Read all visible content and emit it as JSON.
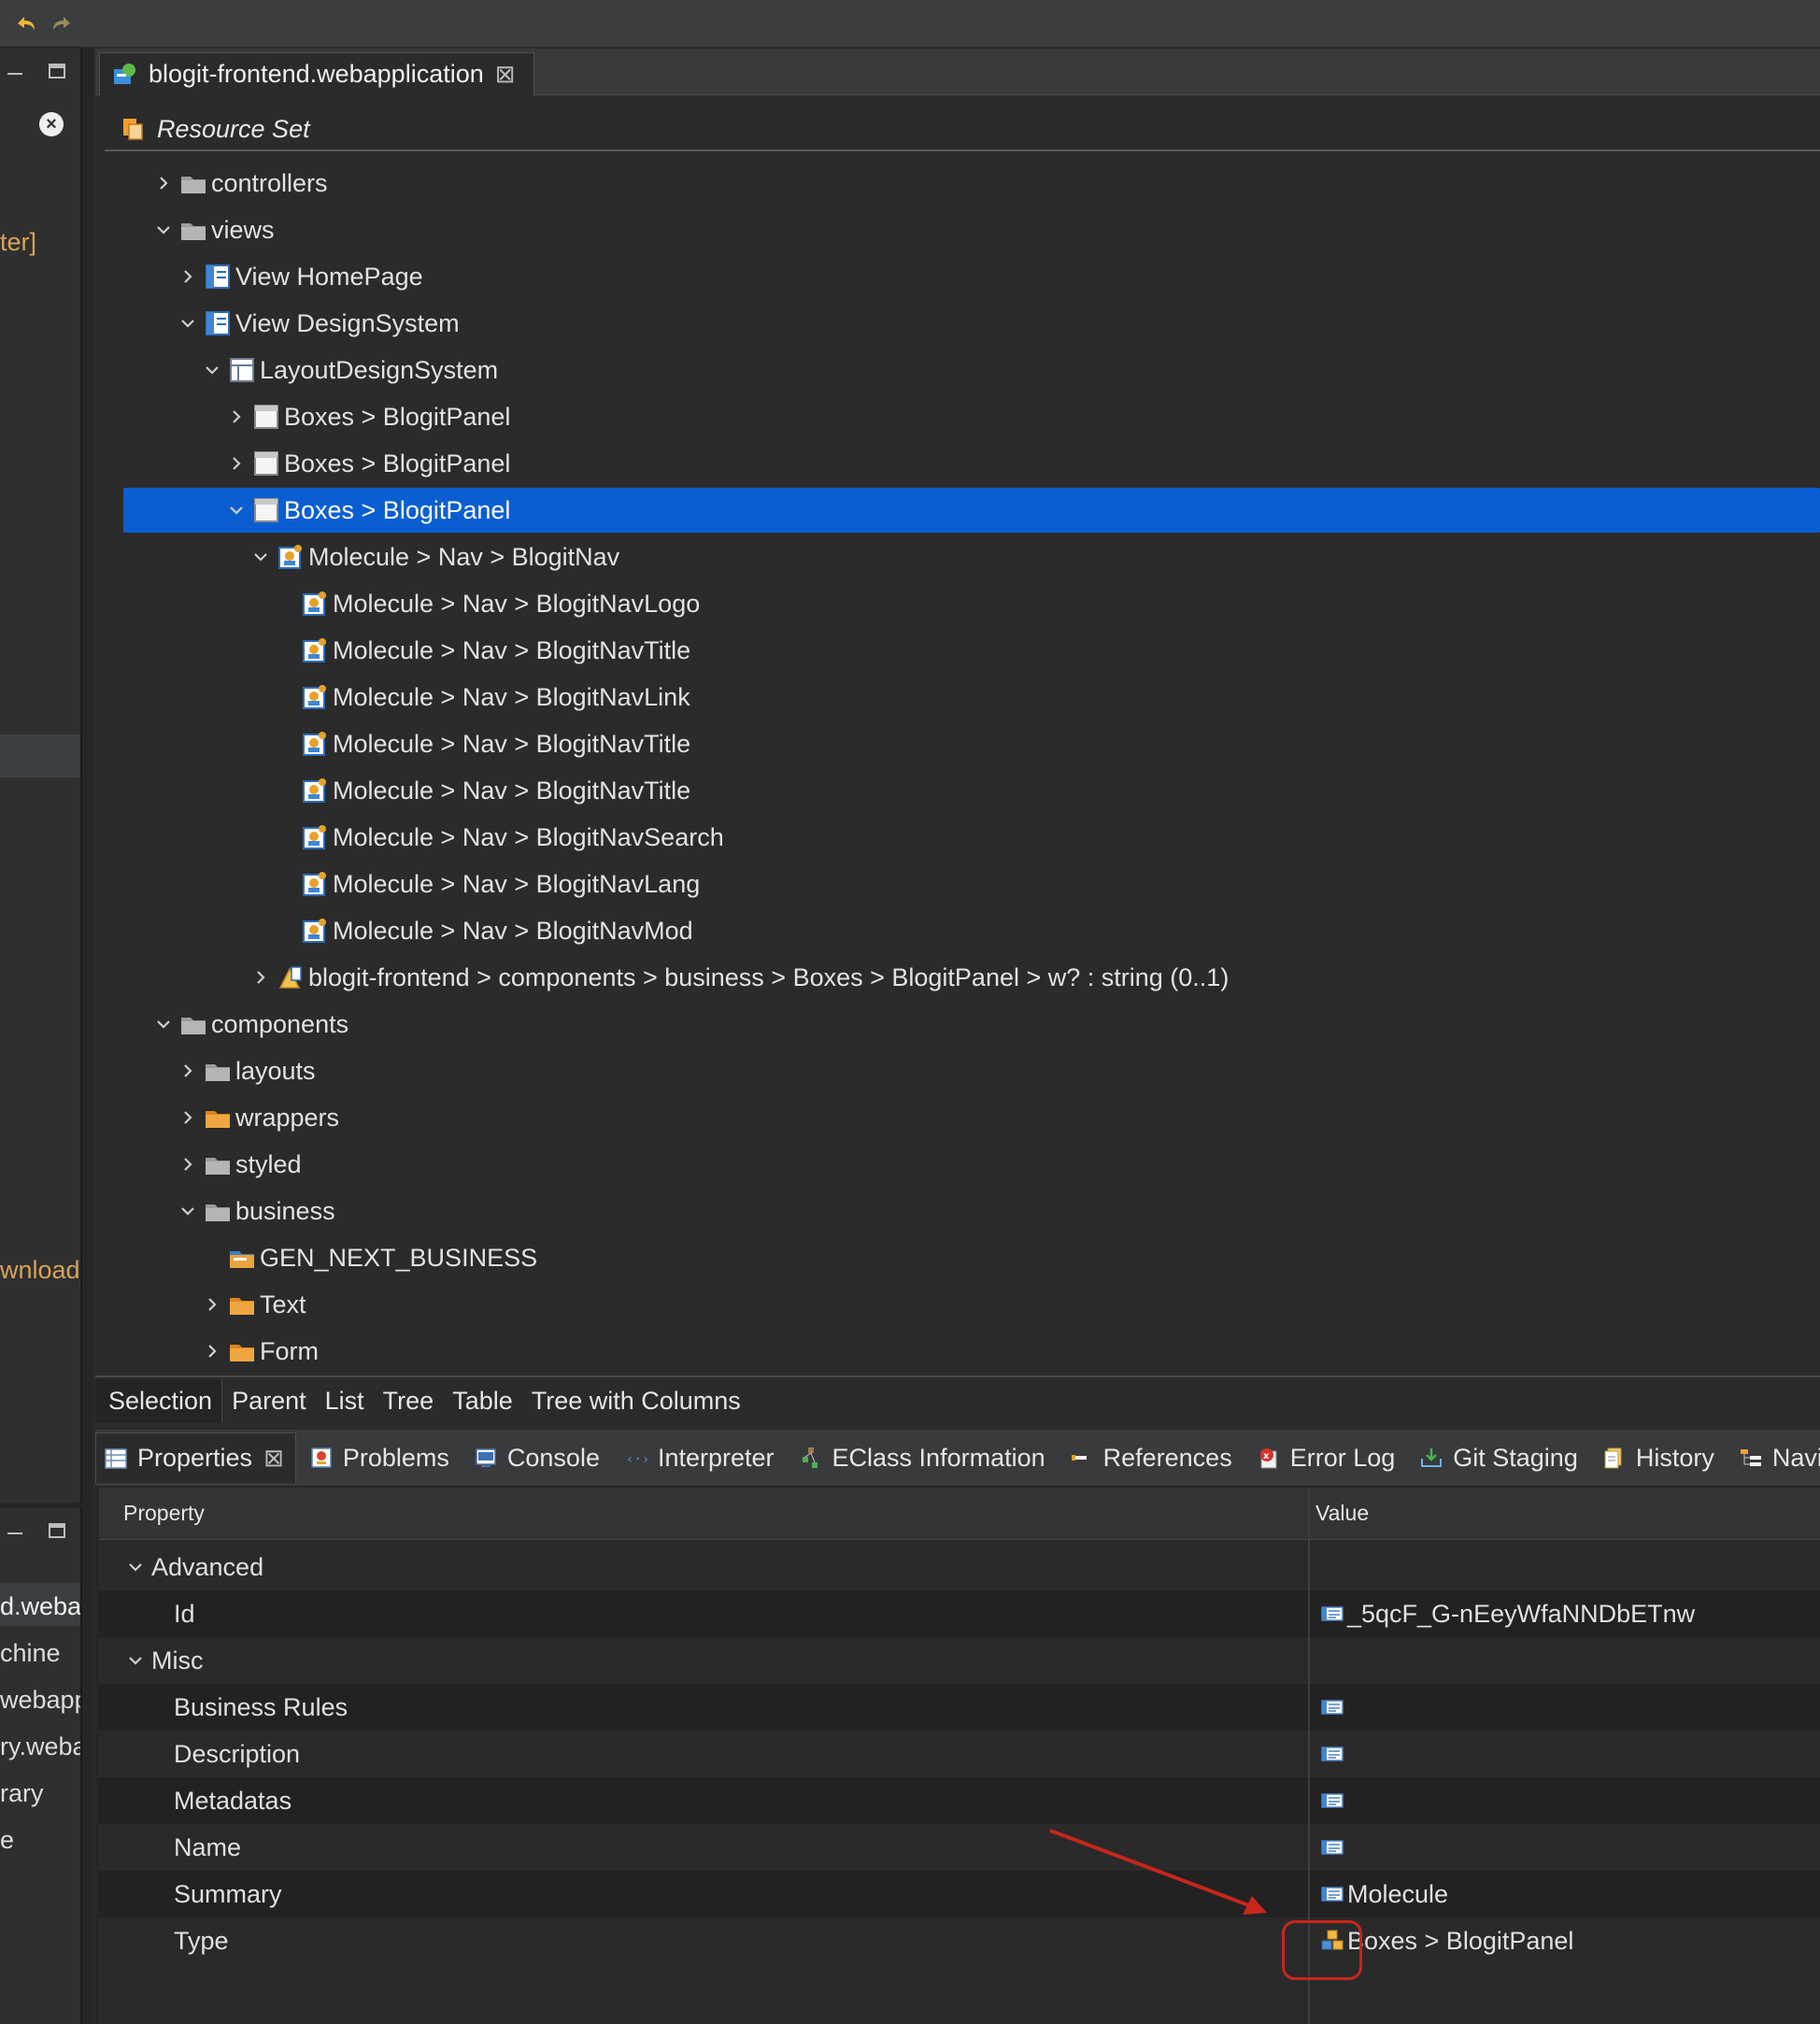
{
  "toolbar": {
    "undo_icon": "undo-icon",
    "redo_icon": "redo-icon"
  },
  "left": {
    "frag1": "ter]",
    "frag2": "wnload]",
    "frag_list": [
      "d.webap",
      "chine",
      "webapp",
      "ry.weba",
      "rary",
      "e"
    ]
  },
  "editor": {
    "tab_label": "blogit-frontend.webapplication",
    "resource_header": "Resource Set",
    "tree": [
      {
        "label": "controllers",
        "indent": 2,
        "state": "collapsed",
        "icon": "folder-gray"
      },
      {
        "label": "views",
        "indent": 2,
        "state": "expanded",
        "icon": "folder-gray"
      },
      {
        "label": "View HomePage",
        "indent": 3,
        "state": "collapsed",
        "icon": "view"
      },
      {
        "label": "View DesignSystem",
        "indent": 3,
        "state": "expanded",
        "icon": "view"
      },
      {
        "label": "LayoutDesignSystem",
        "indent": 4,
        "state": "expanded",
        "icon": "layout"
      },
      {
        "label": "Boxes > BlogitPanel",
        "indent": 5,
        "state": "collapsed",
        "icon": "panel"
      },
      {
        "label": "Boxes > BlogitPanel",
        "indent": 5,
        "state": "collapsed",
        "icon": "panel"
      },
      {
        "label": "Boxes > BlogitPanel",
        "indent": 5,
        "state": "expanded",
        "icon": "panel",
        "selected": true
      },
      {
        "label": "Molecule > Nav > BlogitNav",
        "indent": 6,
        "state": "expanded",
        "icon": "molecule"
      },
      {
        "label": "Molecule > Nav > BlogitNavLogo",
        "indent": 7,
        "state": "none",
        "icon": "molecule"
      },
      {
        "label": "Molecule > Nav > BlogitNavTitle",
        "indent": 7,
        "state": "none",
        "icon": "molecule"
      },
      {
        "label": "Molecule > Nav > BlogitNavLink",
        "indent": 7,
        "state": "none",
        "icon": "molecule"
      },
      {
        "label": "Molecule > Nav > BlogitNavTitle",
        "indent": 7,
        "state": "none",
        "icon": "molecule"
      },
      {
        "label": "Molecule > Nav > BlogitNavTitle",
        "indent": 7,
        "state": "none",
        "icon": "molecule"
      },
      {
        "label": "Molecule > Nav > BlogitNavSearch",
        "indent": 7,
        "state": "none",
        "icon": "molecule"
      },
      {
        "label": "Molecule > Nav > BlogitNavLang",
        "indent": 7,
        "state": "none",
        "icon": "molecule"
      },
      {
        "label": "Molecule > Nav > BlogitNavMod",
        "indent": 7,
        "state": "none",
        "icon": "molecule"
      },
      {
        "label": "blogit-frontend > components > business > Boxes > BlogitPanel > w? : string (0..1)",
        "indent": 6,
        "state": "collapsed",
        "icon": "attribute"
      },
      {
        "label": "components",
        "indent": 2,
        "state": "expanded",
        "icon": "folder-gray"
      },
      {
        "label": "layouts",
        "indent": 3,
        "state": "collapsed",
        "icon": "folder-gray"
      },
      {
        "label": "wrappers",
        "indent": 3,
        "state": "collapsed",
        "icon": "folder-orange"
      },
      {
        "label": "styled",
        "indent": 3,
        "state": "collapsed",
        "icon": "folder-gray"
      },
      {
        "label": "business",
        "indent": 3,
        "state": "expanded",
        "icon": "folder-gray"
      },
      {
        "label": "GEN_NEXT_BUSINESS",
        "indent": 4,
        "state": "none",
        "icon": "folder-blue"
      },
      {
        "label": "Text",
        "indent": 4,
        "state": "collapsed",
        "icon": "folder-orange"
      },
      {
        "label": "Form",
        "indent": 4,
        "state": "collapsed",
        "icon": "folder-orange"
      }
    ],
    "bottom_tabs": [
      "Selection",
      "Parent",
      "List",
      "Tree",
      "Table",
      "Tree with Columns"
    ]
  },
  "properties": {
    "tabs": [
      {
        "label": "Properties",
        "icon": "properties-icon",
        "active": true
      },
      {
        "label": "Problems",
        "icon": "problems-icon"
      },
      {
        "label": "Console",
        "icon": "console-icon"
      },
      {
        "label": "Interpreter",
        "icon": "interpreter-icon"
      },
      {
        "label": "EClass Information",
        "icon": "eclass-icon"
      },
      {
        "label": "References",
        "icon": "references-icon"
      },
      {
        "label": "Error Log",
        "icon": "error-log-icon"
      },
      {
        "label": "Git Staging",
        "icon": "git-staging-icon"
      },
      {
        "label": "History",
        "icon": "history-icon"
      },
      {
        "label": "Navig",
        "icon": "navigator-icon"
      }
    ],
    "col_property": "Property",
    "col_value": "Value",
    "rows": [
      {
        "kind": "category",
        "name": "Advanced",
        "value": ""
      },
      {
        "kind": "prop",
        "name": "Id",
        "value": "_5qcF_G-nEeyWfaNNDbETnw",
        "icon": "text-value-icon"
      },
      {
        "kind": "category",
        "name": "Misc",
        "value": ""
      },
      {
        "kind": "prop",
        "name": "Business Rules",
        "value": "",
        "icon": "text-value-icon"
      },
      {
        "kind": "prop",
        "name": "Description",
        "value": "",
        "icon": "text-value-icon"
      },
      {
        "kind": "prop",
        "name": "Metadatas",
        "value": "",
        "icon": "text-value-icon"
      },
      {
        "kind": "prop",
        "name": "Name",
        "value": "",
        "icon": "text-value-icon"
      },
      {
        "kind": "prop",
        "name": "Summary",
        "value": "Molecule",
        "icon": "text-value-icon"
      },
      {
        "kind": "prop",
        "name": "Type",
        "value": "Boxes > BlogitPanel",
        "icon": "type-ref-icon"
      }
    ]
  },
  "colors": {
    "selection": "#0b5ed2",
    "annotation": "#c8261c",
    "folder_gray": "#9a9a9a",
    "folder_orange": "#e69a2e"
  }
}
